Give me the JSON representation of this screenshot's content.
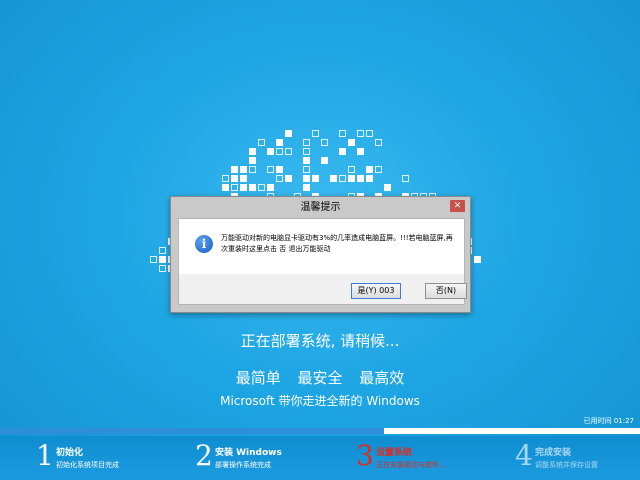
{
  "colors": {
    "background": "#1aa3e2",
    "active_step": "#e02a1c",
    "progress_fill": "#2e8ed8",
    "info_icon": "#1d5fc7"
  },
  "dialog": {
    "title": "温馨提示",
    "close_label": "✕",
    "icon": "info-icon",
    "icon_glyph": "i",
    "message": "万能驱动对新的电脑显卡驱动有3%的几率造成电脑蓝屏。!!!若电脑蓝屏,再次重装时这里点击 否 退出万能驱动",
    "yes_button": "是(Y) 003",
    "no_button": "否(N)"
  },
  "status_text": "正在部署系统, 请稍候...",
  "slogan": "最简单 最安全 最高效",
  "tagline": "Microsoft 带你走进全新的 Windows",
  "elapsed_time": "已用时间  01:27",
  "progress": {
    "fraction": 0.6
  },
  "steps": [
    {
      "num": "1",
      "title": "初始化",
      "subtitle": "初始化系统项目完成",
      "state": "done"
    },
    {
      "num": "2",
      "title": "安装 Windows",
      "subtitle": "部署操作系统完成",
      "state": "done"
    },
    {
      "num": "3",
      "title": "设置系统",
      "subtitle": "正在安装驱动与软件...",
      "state": "active"
    },
    {
      "num": "4",
      "title": "完成安装",
      "subtitle": "调整系统并保存设置",
      "state": "future"
    }
  ]
}
